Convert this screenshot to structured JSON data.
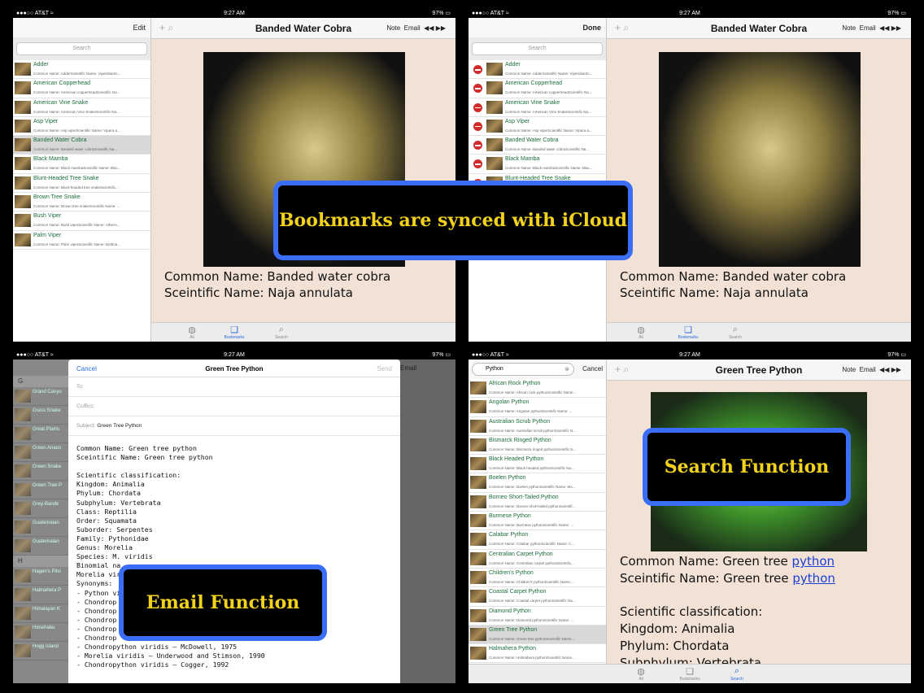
{
  "status": {
    "carrier": "●●●○○ AT&T ≈",
    "time": "9:27 AM",
    "battery": "97% ▭"
  },
  "panel1": {
    "edit": "Edit",
    "search": "Search",
    "title": "Banded Water Cobra",
    "note": "Note",
    "email": "Email",
    "rw": "◀◀",
    "ff": "▶▶",
    "rows": [
      {
        "t": "Adder",
        "s": "Common Name: AdderScientific Name: ViperidaeSc..."
      },
      {
        "t": "American Copperhead",
        "s": "Common Name: American copperheadScientific Na..."
      },
      {
        "t": "American Vine Snake",
        "s": "Common Name: American Vine SnakeScientific Na..."
      },
      {
        "t": "Asp Viper",
        "s": "Common Name: Asp viperScientific Name: Vipera a..."
      },
      {
        "t": "Banded Water Cobra",
        "s": "Common Name: Banded water cobraScientific Na..."
      },
      {
        "t": "Black Mamba",
        "s": "Common Name: Black mambaScientific Name: Blac..."
      },
      {
        "t": "Blunt-Headed Tree Snake",
        "s": "Common Name: Blunt-headed tree snakeScientific..."
      },
      {
        "t": "Brown Tree Snake",
        "s": "Common Name: Brown tree snakeScientific Name: ..."
      },
      {
        "t": "Bush Viper",
        "s": "Common Name: Bush viperScientific Name: Atheris..."
      },
      {
        "t": "Palm Viper",
        "s": "Common Name: Palm viperScientific Name: Bothrie..."
      }
    ],
    "cn": "Common Name: Banded water cobra",
    "sn": "Sceintific Name: Naja annulata",
    "tabs": [
      "All",
      "Bookmarks",
      "Search"
    ],
    "ghost": "Sceintific Name: Naja annulata"
  },
  "panel2": {
    "done": "Done",
    "search": "Search",
    "title": "Banded Water Cobra",
    "note": "Note",
    "email": "Email",
    "rows": [
      {
        "t": "Adder",
        "s": "Common Name: AdderScientific Name: ViperidaeSc..."
      },
      {
        "t": "American Copperhead",
        "s": "Common Name: American copperheadScientific Na..."
      },
      {
        "t": "American Vine Snake",
        "s": "Common Name: American Vine SnakeScientific Na..."
      },
      {
        "t": "Asp Viper",
        "s": "Common Name: Asp viperScientific Name: Vipera a..."
      },
      {
        "t": "Banded Water Cobra",
        "s": "Common Name: Banded water cobraScientific Na..."
      },
      {
        "t": "Black Mamba",
        "s": "Common Name: Black mambaScientific Name: Blac..."
      },
      {
        "t": "Blunt-Headed Tree Snake",
        "s": "Common Name: Blunt-headed tree snakeScientific..."
      }
    ],
    "cn": "Common Name: Banded water cobra",
    "sn": "Sceintific Name: Naja annulata",
    "banner": "Bookmarks are synced with iCloud"
  },
  "panel3": {
    "cancel": "Cancel",
    "title": "Green Tree Python",
    "send": "Send",
    "to": "To:",
    "cc": "Cc/Bcc:",
    "subject_label": "Subject:",
    "subject": "Green Tree Python",
    "email": "Email",
    "sec_g": "G",
    "sec_h": "H",
    "list": [
      "Grand Canyo",
      "Grass Snake",
      "Great Plains",
      "Green Anaco",
      "Green Snake",
      "Green Tree P",
      "Grey-Bande",
      "Guatemalan",
      "Guatemalan"
    ],
    "list2": [
      "Hagen's Pitvi",
      "Halmahera P",
      "Himalayan K",
      "Himehabu",
      "Hogg Island"
    ],
    "body": "Common Name: Green tree python\nSceintific Name: Green tree python\n\nScientific classification:\nKingdom: Animalia\nPhylum: Chordata\nSubphylum: Vertebrata\nClass: Reptilia\nOrder: Squamata\nSuborder: Serpentes\nFamily: Pythonidae\nGenus: Morelia\nSpecies: M. viridis\nBinomial na\nMorelia viri\nSynonyms:\n- Python vir\n- Chondrop\n- Chondrop\n- Chondrop\n- Chondrop\n- Chondrop\n- Chondropython viridis – McDowell, 1975\n- Morelia viridis – Underwood and Stimson, 1990\n- Chondropython viridis – Cogger, 1992",
    "banner": "Email Function"
  },
  "panel4": {
    "query": "Python",
    "cancel": "Cancel",
    "title": "Green Tree Python",
    "note": "Note",
    "email": "Email",
    "rows": [
      {
        "t": "African Rock Python",
        "s": "Common Name: African rock pythonScientific Name..."
      },
      {
        "t": "Angolan Python",
        "s": "Common Name: Angolan pythonScientific Name: ..."
      },
      {
        "t": "Australian Scrub Python",
        "s": "Common Name: Australian scrub pythonScientific N..."
      },
      {
        "t": "Bismarck Ringed Python",
        "s": "Common Name: Bismarck ringed pythonScientific N..."
      },
      {
        "t": "Black Headed Python",
        "s": "Common Name: Black headed pythonScientific Na..."
      },
      {
        "t": "Boelen Python",
        "s": "Common Name: Boelen pythonScientific Name: Mo..."
      },
      {
        "t": "Borneo Short-Tailed Python",
        "s": "Common Name: Borneo short-tailed pythonScientifi..."
      },
      {
        "t": "Burmese Python",
        "s": "Common Name: Burmese pythonScientific Name: ..."
      },
      {
        "t": "Calabar Python",
        "s": "Common Name: Calabar pythonScientific Name: C..."
      },
      {
        "t": "Centralian Carpet Python",
        "s": "Common Name: Centralian carpet pythonScientific..."
      },
      {
        "t": "Children's Python",
        "s": "Common Name: Children's pythonScientific Name:..."
      },
      {
        "t": "Coastal Carpet Python",
        "s": "Common Name: Coastal carpet pythonScientific Na..."
      },
      {
        "t": "Diamond Python",
        "s": "Common Name: Diamond pythonScientific Name: ..."
      },
      {
        "t": "Green Tree Python",
        "s": "Common Name: Green tree pythonScientific Name..."
      },
      {
        "t": "Halmahera Python",
        "s": "Common Name: Halmahera pythonScientific Name..."
      }
    ],
    "cn1": "Common Name: Green tree ",
    "cn1l": "python",
    "sn1": "Sceintific Name: Green tree ",
    "sn1l": "python",
    "sc": "Scientific classification:",
    "k": "Kingdom: Animalia",
    "p": "Phylum: Chordata",
    "sp": "Subphylum: Vertebrata",
    "banner": "Search Function"
  }
}
